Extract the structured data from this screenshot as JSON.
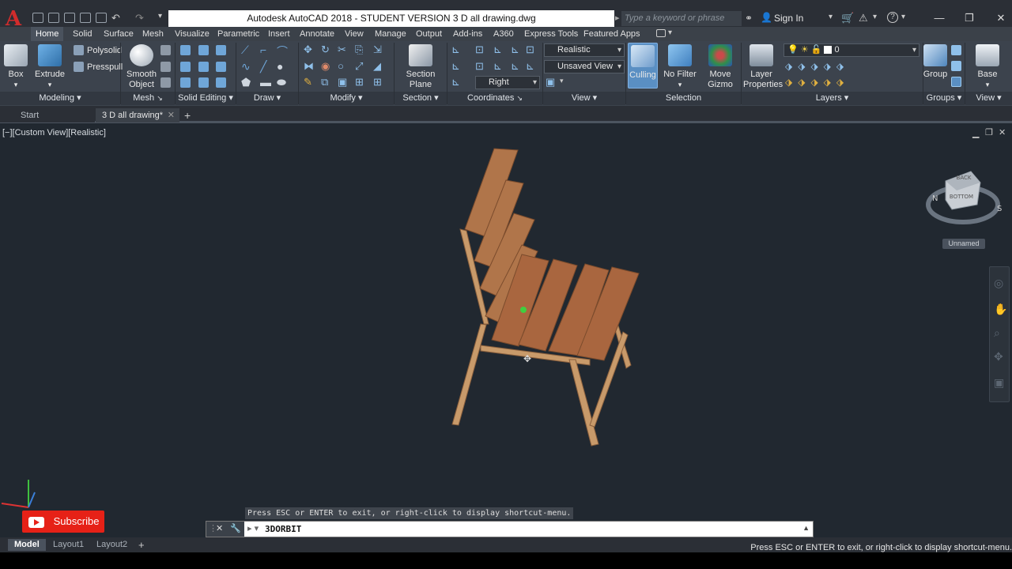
{
  "titlebar": {
    "app_title": "Autodesk AutoCAD 2018 - STUDENT VERSION    3 D all drawing.dwg",
    "search_placeholder": "Type a keyword or phrase",
    "sign_in": "Sign In",
    "app_letter": "A"
  },
  "ribbon_tabs": [
    "Home",
    "Solid",
    "Surface",
    "Mesh",
    "Visualize",
    "Parametric",
    "Insert",
    "Annotate",
    "View",
    "Manage",
    "Output",
    "Add-ins",
    "A360",
    "Express Tools",
    "Featured Apps"
  ],
  "ribbon": {
    "box": "Box",
    "extrude": "Extrude",
    "polysolid": "Polysolid",
    "presspull": "Presspull",
    "smooth_object_1": "Smooth",
    "smooth_object_2": "Object",
    "section_plane_1": "Section",
    "section_plane_2": "Plane",
    "visual_style": "Realistic",
    "named_view": "Unsaved View",
    "view_dir": "Right",
    "culling": "Culling",
    "no_filter": "No Filter",
    "move_gizmo_1": "Move",
    "move_gizmo_2": "Gizmo",
    "layer_props_1": "Layer",
    "layer_props_2": "Properties",
    "layer_value": "0",
    "group": "Group",
    "base": "Base"
  },
  "panels": [
    "Modeling",
    "Mesh",
    "Solid Editing",
    "Draw",
    "Modify",
    "Section",
    "Coordinates",
    "View",
    "Selection",
    "Layers",
    "Groups",
    "View"
  ],
  "file_tabs": [
    "Start",
    "3 D all drawing*"
  ],
  "viewport": {
    "label": "[−][Custom View][Realistic]",
    "viewcube_top": "BACK",
    "viewcube_face": "BOTTOM",
    "compass_s": "S",
    "compass_n": "N",
    "ucs_name": "Unnamed"
  },
  "command": {
    "message": "Press ESC or ENTER to exit, or right-click to display shortcut-menu.",
    "input": "3DORBIT"
  },
  "layout_tabs": [
    "Model",
    "Layout1",
    "Layout2"
  ],
  "status_message": "Press ESC or ENTER to exit, or right-click to display shortcut-menu.",
  "subscribe": "Subscribe",
  "colors": {
    "accent": "#4a90d9",
    "wood": "#b0754a",
    "frame": "#c89a6a",
    "bg": "#212830"
  }
}
